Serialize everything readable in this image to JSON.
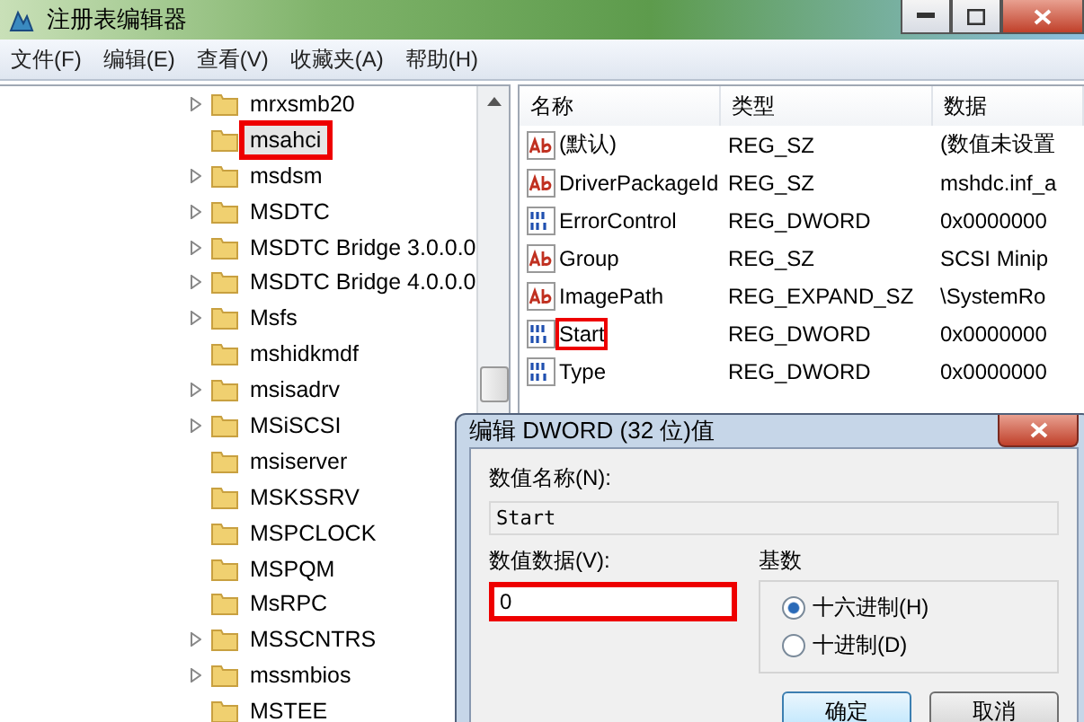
{
  "window": {
    "title": "注册表编辑器"
  },
  "menu": [
    "文件(F)",
    "编辑(E)",
    "查看(V)",
    "收藏夹(A)",
    "帮助(H)"
  ],
  "tree": [
    {
      "label": "mrxsmb20",
      "expandable": true,
      "selected": false,
      "highlighted": false
    },
    {
      "label": "msahci",
      "expandable": false,
      "selected": true,
      "highlighted": true
    },
    {
      "label": "msdsm",
      "expandable": true,
      "selected": false,
      "highlighted": false
    },
    {
      "label": "MSDTC",
      "expandable": true,
      "selected": false,
      "highlighted": false
    },
    {
      "label": "MSDTC Bridge 3.0.0.0",
      "expandable": true,
      "selected": false,
      "highlighted": false
    },
    {
      "label": "MSDTC Bridge 4.0.0.0",
      "expandable": true,
      "selected": false,
      "highlighted": false
    },
    {
      "label": "Msfs",
      "expandable": true,
      "selected": false,
      "highlighted": false
    },
    {
      "label": "mshidkmdf",
      "expandable": false,
      "selected": false,
      "highlighted": false
    },
    {
      "label": "msisadrv",
      "expandable": true,
      "selected": false,
      "highlighted": false
    },
    {
      "label": "MSiSCSI",
      "expandable": true,
      "selected": false,
      "highlighted": false
    },
    {
      "label": "msiserver",
      "expandable": false,
      "selected": false,
      "highlighted": false
    },
    {
      "label": "MSKSSRV",
      "expandable": false,
      "selected": false,
      "highlighted": false
    },
    {
      "label": "MSPCLOCK",
      "expandable": false,
      "selected": false,
      "highlighted": false
    },
    {
      "label": "MSPQM",
      "expandable": false,
      "selected": false,
      "highlighted": false
    },
    {
      "label": "MsRPC",
      "expandable": false,
      "selected": false,
      "highlighted": false
    },
    {
      "label": "MSSCNTRS",
      "expandable": true,
      "selected": false,
      "highlighted": false
    },
    {
      "label": "mssmbios",
      "expandable": true,
      "selected": false,
      "highlighted": false
    },
    {
      "label": "MSTEE",
      "expandable": false,
      "selected": false,
      "highlighted": false
    }
  ],
  "values": {
    "columns": [
      "名称",
      "类型",
      "数据"
    ],
    "rows": [
      {
        "kind": "string",
        "name": "(默认)",
        "type": "REG_SZ",
        "data": "(数值未设置",
        "highlighted": false
      },
      {
        "kind": "string",
        "name": "DriverPackageId",
        "type": "REG_SZ",
        "data": "mshdc.inf_a",
        "highlighted": false
      },
      {
        "kind": "dword",
        "name": "ErrorControl",
        "type": "REG_DWORD",
        "data": "0x0000000",
        "highlighted": false
      },
      {
        "kind": "string",
        "name": "Group",
        "type": "REG_SZ",
        "data": "SCSI Minip",
        "highlighted": false
      },
      {
        "kind": "string",
        "name": "ImagePath",
        "type": "REG_EXPAND_SZ",
        "data": "\\SystemRo",
        "highlighted": false
      },
      {
        "kind": "dword",
        "name": "Start",
        "type": "REG_DWORD",
        "data": "0x0000000",
        "highlighted": true
      },
      {
        "kind": "dword",
        "name": "Type",
        "type": "REG_DWORD",
        "data": "0x0000000",
        "highlighted": false
      }
    ]
  },
  "dialog": {
    "title": "编辑 DWORD (32 位)值",
    "name_label": "数值名称(N):",
    "name_value": "Start",
    "data_label": "数值数据(V):",
    "data_value": "0",
    "data_highlighted": true,
    "base_label": "基数",
    "bases": [
      {
        "label": "十六进制(H)",
        "selected": true
      },
      {
        "label": "十进制(D)",
        "selected": false
      }
    ],
    "buttons": [
      {
        "label": "确定",
        "default": true
      },
      {
        "label": "取消",
        "default": false
      }
    ]
  }
}
